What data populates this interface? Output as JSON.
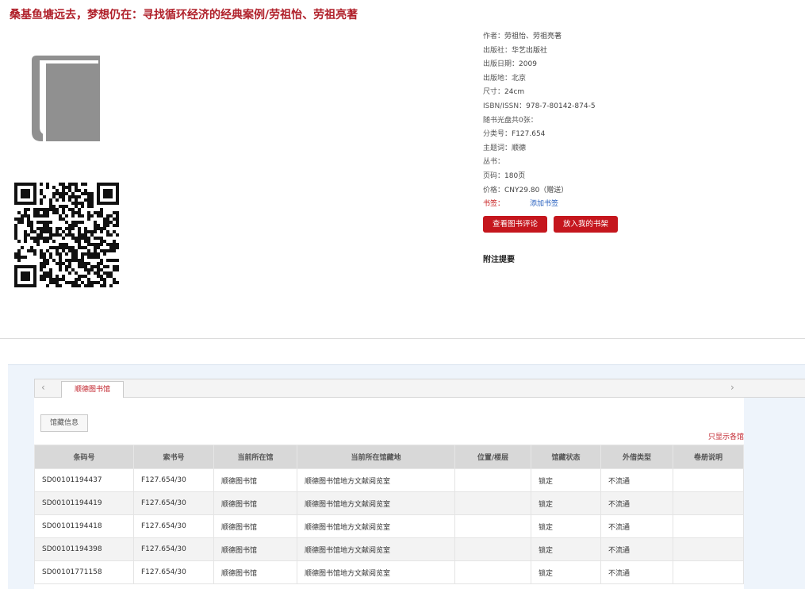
{
  "page": {
    "title": "桑基鱼塘远去，梦想仍在：寻找循环经济的经典案例/劳祖怡、劳祖亮著"
  },
  "icons": {
    "cover": "book-icon",
    "qr": "qr-code-icon"
  },
  "meta": [
    {
      "label": "作者：",
      "value": "劳祖怡、劳祖亮著"
    },
    {
      "label": "出版社：",
      "value": "华艺出版社"
    },
    {
      "label": "出版日期：",
      "value": "2009"
    },
    {
      "label": "出版地：",
      "value": "北京"
    },
    {
      "label": "尺寸：",
      "value": "24cm"
    },
    {
      "label": "ISBN/ISSN：",
      "value": "978-7-80142-874-5"
    },
    {
      "label": "随书光盘共0张：",
      "value": ""
    },
    {
      "label": "分类号：",
      "value": "F127.654"
    },
    {
      "label": "主题词：",
      "value": "顺德"
    },
    {
      "label": "丛书：",
      "value": ""
    },
    {
      "label": "页码：",
      "value": "180页"
    },
    {
      "label": "价格：",
      "value": "CNY29.80（赠送）"
    }
  ],
  "tags": {
    "label": "书签：",
    "add_link": "添加书签"
  },
  "buttons": {
    "review": "查看图书评论",
    "shelf": "放入我的书架"
  },
  "notes_heading": "附注提要",
  "holdings": {
    "library_tab": "顺德图书馆",
    "info_tab": "馆藏信息",
    "only_this_lib": "只显示各馆",
    "nav_prev": "‹",
    "nav_next": "›",
    "columns": [
      "条码号",
      "索书号",
      "当前所在馆",
      "当前所在馆藏地",
      "位置/楼层",
      "馆藏状态",
      "外借类型",
      "卷册说明"
    ],
    "rows": [
      [
        "SD00101194437",
        "F127.654/30",
        "顺德图书馆",
        "顺德图书馆地方文献阅览室",
        "",
        "锁定",
        "不流通",
        ""
      ],
      [
        "SD00101194419",
        "F127.654/30",
        "顺德图书馆",
        "顺德图书馆地方文献阅览室",
        "",
        "锁定",
        "不流通",
        ""
      ],
      [
        "SD00101194418",
        "F127.654/30",
        "顺德图书馆",
        "顺德图书馆地方文献阅览室",
        "",
        "锁定",
        "不流通",
        ""
      ],
      [
        "SD00101194398",
        "F127.654/30",
        "顺德图书馆",
        "顺德图书馆地方文献阅览室",
        "",
        "锁定",
        "不流通",
        ""
      ],
      [
        "SD00101771158",
        "F127.654/30",
        "顺德图书馆",
        "顺德图书馆地方文献阅览室",
        "",
        "锁定",
        "不流通",
        ""
      ]
    ]
  }
}
